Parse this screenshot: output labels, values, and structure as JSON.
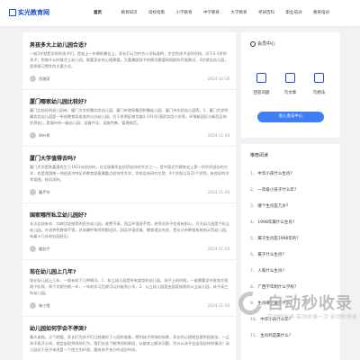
{
  "header": {
    "logo": "实光教育网",
    "nav": [
      "首页",
      "教育知识",
      "母校指南",
      "小学教育",
      "中学教育",
      "大学教育",
      "考研百科",
      "职业培训",
      "教育培训"
    ],
    "active_index": 0
  },
  "articles": [
    {
      "title": "男孩多大上幼儿园合适?",
      "summary": "一般3岁就是学前的孩子们，是幼上一年期的最佳上，家长们认为符合入学标准的，才会把孩子送到学校。对于2-3岁的孩子，到底什么时候才上幼儿园，既要家长的心理需要，又要兼顾孩子的情况需要和同龄的可能情况，3岁就去幼儿园，是伴随习惯性的主要方式。",
      "author": "西维家",
      "date": "2024-11-18"
    },
    {
      "title": "厦门哪家幼儿园比较好?",
      "summary": "厦门比较好的幼儿园有：厦门大学附属实验幼儿园、厦门市港丽集团附属幼儿园、厦门市实验幼儿园等。1、厦门大学附属实验幼儿园是一所经教育局批准的公办幼儿园，位于思明区南华路4-101号(演武实验小学旁，环境新园区与新西区的交界处)，是福州市一级幼儿园，设备齐全，设施完善，管理规范。",
      "author": "四叶草",
      "date": "2024-11-18"
    },
    {
      "title": "厦门大学值得去吗?",
      "summary": "厦门大学是陈嘉庚先生于1921年创办的，在全国最早由华侨创办的大学之一，是中国近代教育史上第一所华侨创办的大学，也是我国唯一地处经济特区的教育部直属重点综合性大学。学校设有研究生院、6个学部以及31个学院，有良好的学术氛围，校风淳朴。",
      "author": "蘑芹你",
      "date": "2024-11-18"
    },
    {
      "title": "国家哪所私立幼儿园好?",
      "summary": "长沙比较有名、口碑比较推荐的民办幼儿园，收费不高，而且环境很不错，老师对孩子也很有耐心，贝贝幼儿园是个私立幼儿园，外语特色教育不错，总体硬件和师资都还好，园区环境优美、教育理念先进，是长沙市教育系统的示范幼儿园，有着十几年的办园经历。",
      "author": "暖软宁",
      "date": "2024-11-18"
    },
    {
      "title": "现在幼儿园上几年?",
      "summary": "现在幼儿园上几年，一般有如下几种情况，1、私立幼儿园是所有类型的幼儿园，孩子上的时候，一般需要读中班和大班两个阶段，两个学期为期一年，一年的学习后就可以升级到小学。2、公立幼儿园是由国家拨款的公立幼儿园，孩子读三年幼儿园。",
      "author": "咖小雪",
      "date": "2024-11-18"
    },
    {
      "title": "幼儿园如何学会不停哭?",
      "summary": "春天来临，天气转暖，家长们为孩子们已经做好了入园的准备，想到孩子哭闹的场景，家长的心理就会感到很紧张，一旦孩子离开父母，就会出现哭闹的行为，我们应该了解哭闹的原因，从根本上解决问题，为什么孩子会出现这样的情况？幼儿园对于孩子来说是一个陌生的环境，要给孩子充分的适应时间。",
      "author": "",
      "date": ""
    }
  ],
  "user_center": {
    "title": "会员中心",
    "buttons": [
      "回答问题",
      "写文章",
      "写想法"
    ],
    "enter": "进入会员中心"
  },
  "recommend": {
    "title": "推荐阅读",
    "items": [
      {
        "num": "1、",
        "text": "中华小孩什么生肖?"
      },
      {
        "num": "2、",
        "text": "一年级小孩子什么年?"
      },
      {
        "num": "3、",
        "text": "哪个生肖是几岁?"
      },
      {
        "num": "4、",
        "text": "1998年属什么生肖?"
      },
      {
        "num": "5、",
        "text": "属于生肖是1996年的?"
      },
      {
        "num": "6、",
        "text": "属于什么生肖?"
      },
      {
        "num": "7、",
        "text": "人和什么生肖?"
      },
      {
        "num": "8、",
        "text": "广西学年制什么学校?"
      },
      {
        "num": "9、",
        "text": "生肖哪个属于什么?"
      },
      {
        "num": "10、",
        "text": "中华小孩什么年?"
      },
      {
        "num": "11、",
        "text": "生肖鸡是属什么?"
      }
    ]
  },
  "watermark": {
    "text": "自动秒收录",
    "sub": "自动秒收录·自动收录一次·自动秒收录"
  }
}
